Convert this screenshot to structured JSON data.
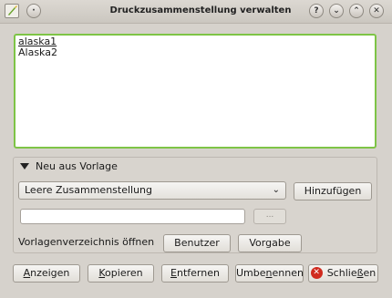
{
  "window": {
    "title": "Druckzusammenstellung verwalten",
    "buttons": {
      "help": "?",
      "shade": "⌄",
      "minimize": "⌃",
      "close": "✕"
    }
  },
  "compositions": [
    "alaska1",
    "Alaska2"
  ],
  "template_group": {
    "header": "Neu aus Vorlage",
    "combo_value": "Leere Zusammenstellung",
    "add_button": "Hinzufügen",
    "path_value": "",
    "browse_button": "...",
    "dir_label": "Vorlagenverzeichnis öffnen",
    "user_button": "Benutzer",
    "default_button": "Vorgabe"
  },
  "actions": {
    "show": {
      "first": "A",
      "rest": "nzeigen"
    },
    "copy": {
      "first": "K",
      "rest": "opieren"
    },
    "remove": {
      "first": "E",
      "rest": "ntfernen"
    },
    "rename": {
      "pre": "Umbe",
      "u": "n",
      "post": "ennen"
    },
    "close": {
      "pre": "Schlie",
      "u": "ß",
      "post": "en"
    }
  },
  "colors": {
    "accent": "#7ec446",
    "close_icon": "#d02a1e"
  }
}
